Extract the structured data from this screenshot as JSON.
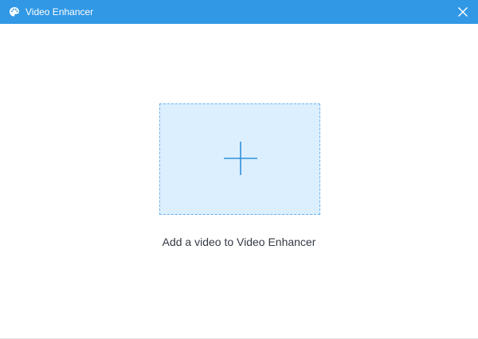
{
  "window": {
    "title": "Video Enhancer",
    "title_icon": "palette-icon",
    "close_icon": "close-icon"
  },
  "colors": {
    "titlebar": "#3198e6",
    "drop_zone_fill": "#dcefff",
    "drop_zone_border": "#6cb3ea",
    "plus": "#2f8fd8",
    "hint_text": "#333a44"
  },
  "main": {
    "drop_zone_icon": "plus-icon",
    "hint": "Add a video to Video Enhancer"
  }
}
